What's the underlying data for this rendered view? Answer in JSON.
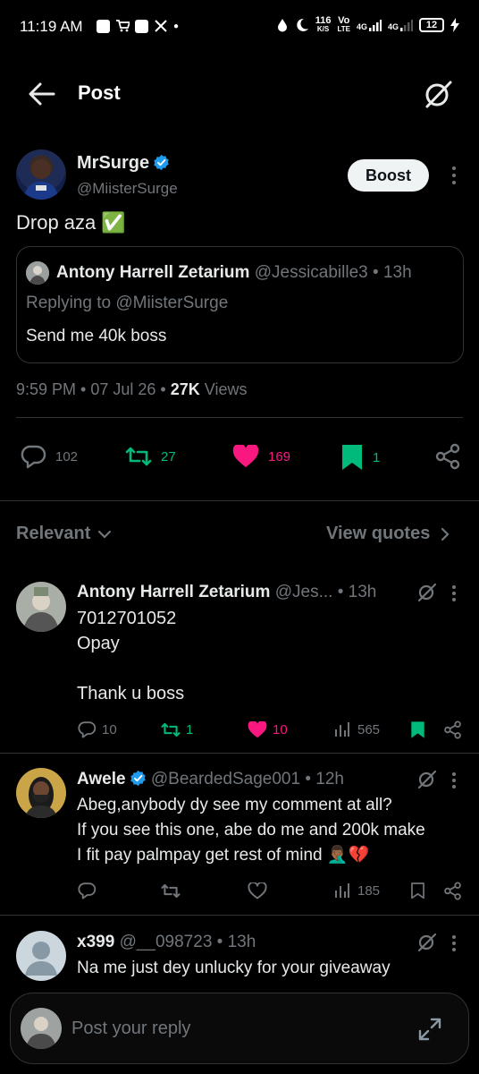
{
  "status": {
    "time": "11:19 AM",
    "speed": "116",
    "speed_unit": "K/S",
    "vo": "Vo",
    "lte": "LTE",
    "net1": "4G",
    "net2": "4G",
    "battery": "12"
  },
  "header": {
    "title": "Post"
  },
  "post": {
    "author_name": "MrSurge",
    "author_handle": "@MiisterSurge",
    "boost_label": "Boost",
    "text": "Drop aza ✅",
    "quote": {
      "name": "Antony Harrell Zetarium",
      "handle": "@Jessicabille3",
      "sep": "•",
      "time": "13h",
      "replying": "Replying to @MiisterSurge",
      "text": "Send me 40k boss"
    },
    "meta_time": "9:59 PM • 07 Jul 26 •",
    "views_count": "27K",
    "views_label": "Views",
    "stats": {
      "replies": "102",
      "reposts": "27",
      "likes": "169",
      "bookmarks": "1"
    }
  },
  "sort": {
    "label": "Relevant",
    "view_quotes": "View quotes"
  },
  "replies": [
    {
      "name": "Antony Harrell Zetarium",
      "handle": "@Jes...",
      "sep": "•",
      "time": "13h",
      "line1": "7012701052",
      "line2": "Opay",
      "line3": "Thank u boss",
      "replies": "10",
      "reposts": "1",
      "likes": "10",
      "views": "565"
    },
    {
      "name": "Awele",
      "handle": "@BeardedSage001",
      "sep": "•",
      "time": "12h",
      "line1": "Abeg,anybody dy see my comment at all?",
      "line2": "If you see this one, abe do me and 200k make",
      "line3": "I fit pay palmpay get rest of mind 🤦🏾‍♂️💔",
      "views": "185"
    },
    {
      "name": "x399",
      "handle": "@__098723",
      "sep": "•",
      "time": "13h",
      "line1": "Na me just dey unlucky for your giveaway"
    }
  ],
  "reply_box": {
    "placeholder": "Post your reply"
  },
  "colors": {
    "like": "#f91880",
    "repost": "#00ba7c",
    "bookmark": "#00ba7c",
    "verified": "#1d9bf0"
  }
}
